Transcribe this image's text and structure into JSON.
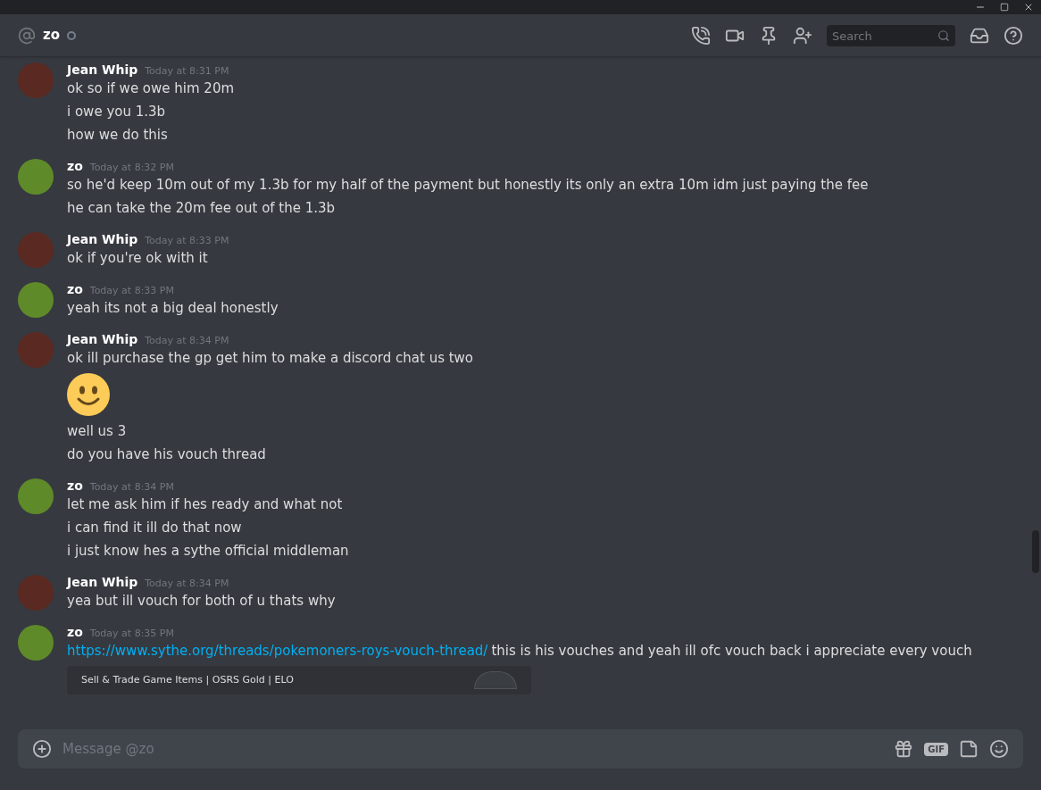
{
  "header": {
    "channel": "zo",
    "search": {
      "placeholder": "Search"
    }
  },
  "messages": [
    {
      "author": "Jean Whip",
      "time": "Today at 8:31 PM",
      "color": "#5a2a22",
      "lines": [
        {
          "kind": "text",
          "text": "ok so if we owe him 20m"
        },
        {
          "kind": "text",
          "text": "i owe you 1.3b"
        },
        {
          "kind": "text",
          "text": "how we do this"
        }
      ]
    },
    {
      "author": "zo",
      "time": "Today at 8:32 PM",
      "color": "#5f8a2a",
      "lines": [
        {
          "kind": "text",
          "text": "so he'd keep 10m out of my 1.3b for my half of the payment but honestly its only an extra 10m idm just paying the fee"
        },
        {
          "kind": "text",
          "text": "he can take the 20m fee out of the 1.3b"
        }
      ]
    },
    {
      "author": "Jean Whip",
      "time": "Today at 8:33 PM",
      "color": "#5a2a22",
      "lines": [
        {
          "kind": "text",
          "text": "ok if you're ok with it"
        }
      ]
    },
    {
      "author": "zo",
      "time": "Today at 8:33 PM",
      "color": "#5f8a2a",
      "lines": [
        {
          "kind": "text",
          "text": "yeah its not a big deal honestly"
        }
      ]
    },
    {
      "author": "Jean Whip",
      "time": "Today at 8:34 PM",
      "color": "#5a2a22",
      "lines": [
        {
          "kind": "text",
          "text": "ok ill purchase the gp get him to make a discord chat us two"
        },
        {
          "kind": "emoji"
        },
        {
          "kind": "text",
          "text": "well us 3"
        },
        {
          "kind": "text",
          "text": "do you have his vouch thread"
        }
      ]
    },
    {
      "author": "zo",
      "time": "Today at 8:34 PM",
      "color": "#5f8a2a",
      "lines": [
        {
          "kind": "text",
          "text": "let me ask him if hes ready and what not"
        },
        {
          "kind": "text",
          "text": "i can find it ill do that now"
        },
        {
          "kind": "text",
          "text": "i just know hes a sythe official middleman"
        }
      ]
    },
    {
      "author": "Jean Whip",
      "time": "Today at 8:34 PM",
      "color": "#5a2a22",
      "lines": [
        {
          "kind": "text",
          "text": "yea but ill vouch for both of u thats why"
        }
      ]
    },
    {
      "author": "zo",
      "time": "Today at 8:35 PM",
      "color": "#5f8a2a",
      "lines": [
        {
          "kind": "link",
          "link": "https://www.sythe.org/threads/pokemoners-roys-vouch-thread/",
          "text": "this is his vouches and yeah ill ofc vouch back i appreciate every vouch"
        },
        {
          "kind": "embed",
          "title": "Sell & Trade Game Items | OSRS Gold | ELO"
        }
      ]
    }
  ],
  "composer": {
    "placeholder": "Message @zo",
    "gif": "GIF"
  }
}
